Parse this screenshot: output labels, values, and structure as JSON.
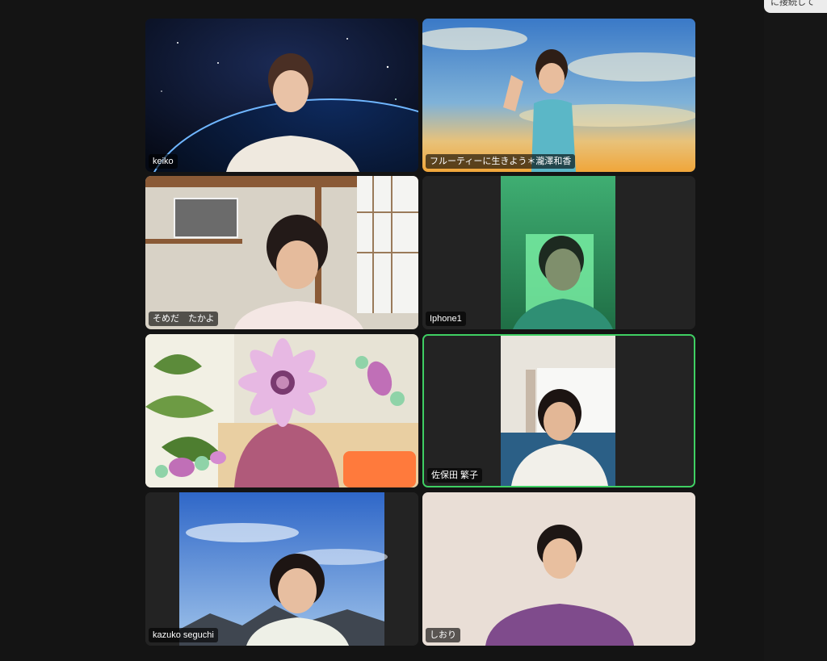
{
  "app": {
    "notification_text": "に接続して"
  },
  "gallery": {
    "participants": [
      {
        "name": "keiko",
        "background": "earth-from-space"
      },
      {
        "name": "フルーティーに生きよう＊瀧澤和香",
        "background": "sunset-sky"
      },
      {
        "name": "そめだ　たかよ",
        "background": "japanese-room"
      },
      {
        "name": "Iphone1",
        "background": "green-curtain"
      },
      {
        "name": "",
        "background": "flower-filter"
      },
      {
        "name": "佐保田 繁子",
        "background": "living-room",
        "active_speaker": true
      },
      {
        "name": "kazuko seguchi",
        "background": "blue-sky-mountains"
      },
      {
        "name": "しおり",
        "background": "plain-wall"
      }
    ]
  },
  "colors": {
    "app_background": "#141414",
    "tile_background": "#232323",
    "active_speaker_border": "#3fcf63",
    "name_tag_background": "rgba(0,0,0,0.62)"
  }
}
